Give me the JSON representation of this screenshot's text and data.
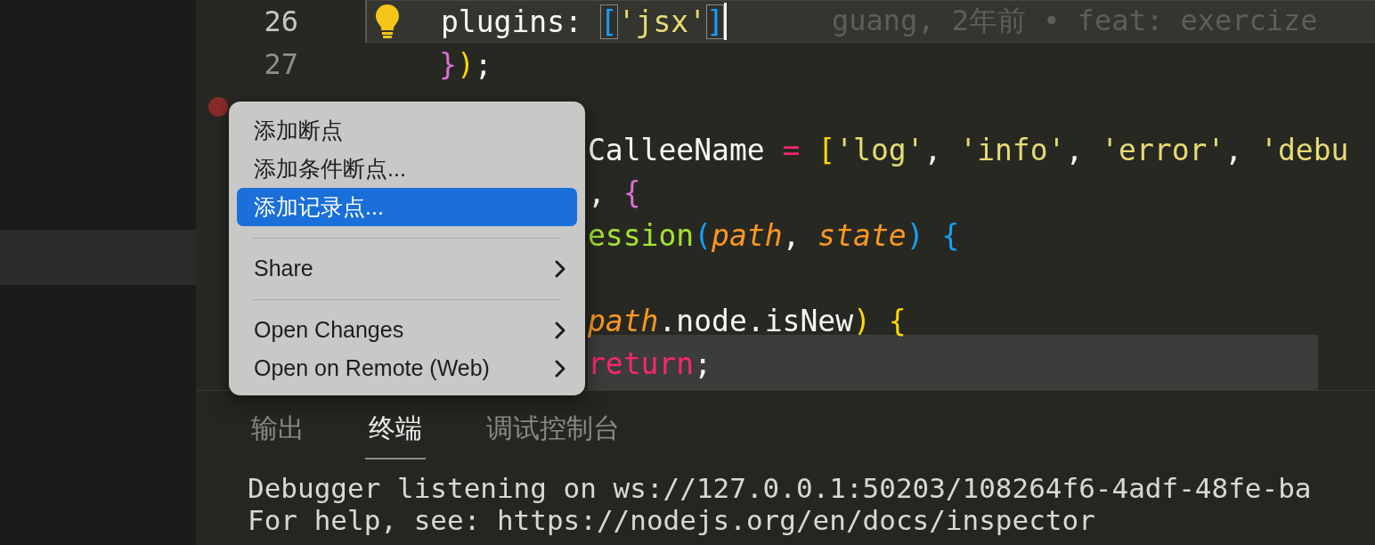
{
  "editor": {
    "lines": [
      {
        "kind": "full",
        "number": "26",
        "current": true,
        "lightbulb": true,
        "tokens": [
          {
            "text": "plugins: ",
            "color": "#f8f8f2"
          },
          {
            "text": "[",
            "color": "#179fff",
            "boxed": true
          },
          {
            "text": "'jsx'",
            "color": "#e6db74"
          },
          {
            "text": "]",
            "color": "#179fff",
            "boxed": true
          }
        ],
        "blame": "guang, 2年前 • feat: exercize"
      },
      {
        "kind": "full",
        "number": "27",
        "current": false,
        "tokens": [
          {
            "text": "}",
            "color": "#da70d6"
          },
          {
            "text": ")",
            "color": "#ffd700"
          },
          {
            "text": ";",
            "color": "#f8f8f2"
          }
        ]
      },
      {
        "kind": "partial",
        "breakpoint": true
      },
      {
        "kind": "partial",
        "tokens": [
          {
            "text": "CalleeName ",
            "color": "#f8f8f2"
          },
          {
            "text": "= ",
            "color": "#f92672"
          },
          {
            "text": "[",
            "color": "#ffd700"
          },
          {
            "text": "'log'",
            "color": "#e6db74"
          },
          {
            "text": ", ",
            "color": "#f8f8f2"
          },
          {
            "text": "'info'",
            "color": "#e6db74"
          },
          {
            "text": ", ",
            "color": "#f8f8f2"
          },
          {
            "text": "'error'",
            "color": "#e6db74"
          },
          {
            "text": ", ",
            "color": "#f8f8f2"
          },
          {
            "text": "'debu",
            "color": "#e6db74"
          }
        ]
      },
      {
        "kind": "partial",
        "tokens": [
          {
            "text": ", ",
            "color": "#f8f8f2"
          },
          {
            "text": "{",
            "color": "#da70d6"
          }
        ]
      },
      {
        "kind": "partial",
        "tokens": [
          {
            "text": "ession",
            "color": "#a6e22e"
          },
          {
            "text": "(",
            "color": "#179fff"
          },
          {
            "text": "path",
            "color": "#fd971f",
            "italic": true
          },
          {
            "text": ", ",
            "color": "#f8f8f2"
          },
          {
            "text": "state",
            "color": "#fd971f",
            "italic": true
          },
          {
            "text": ") {",
            "color": "#179fff"
          }
        ]
      },
      {
        "kind": "partial"
      },
      {
        "kind": "partial",
        "tokens": [
          {
            "text": "path",
            "color": "#fd971f",
            "italic": true
          },
          {
            "text": ".node.isNew",
            "color": "#f8f8f2"
          },
          {
            "text": ") {",
            "color": "#ffd700"
          }
        ]
      },
      {
        "kind": "partial",
        "tokens": [
          {
            "text": "return",
            "color": "#f92672"
          },
          {
            "text": ";",
            "color": "#f8f8f2"
          }
        ]
      }
    ]
  },
  "context_menu": {
    "items": [
      {
        "kind": "item",
        "label": "添加断点",
        "selected": false,
        "submenu": false
      },
      {
        "kind": "item",
        "label": "添加条件断点...",
        "selected": false,
        "submenu": false
      },
      {
        "kind": "item",
        "label": "添加记录点...",
        "selected": true,
        "submenu": false
      },
      {
        "kind": "separator"
      },
      {
        "kind": "item",
        "label": "Share",
        "selected": false,
        "submenu": true
      },
      {
        "kind": "separator"
      },
      {
        "kind": "item",
        "label": "Open Changes",
        "selected": false,
        "submenu": true
      },
      {
        "kind": "item",
        "label": "Open on Remote (Web)",
        "selected": false,
        "submenu": true
      }
    ]
  },
  "panel": {
    "tabs": [
      {
        "label": "输出",
        "selected": false
      },
      {
        "label": "终端",
        "selected": true
      },
      {
        "label": "调试控制台",
        "selected": false
      }
    ],
    "terminal_lines": [
      "Debugger listening on ws://127.0.0.1:50203/108264f6-4adf-48fe-ba",
      "For help, see: https://nodejs.org/en/docs/inspector"
    ]
  }
}
